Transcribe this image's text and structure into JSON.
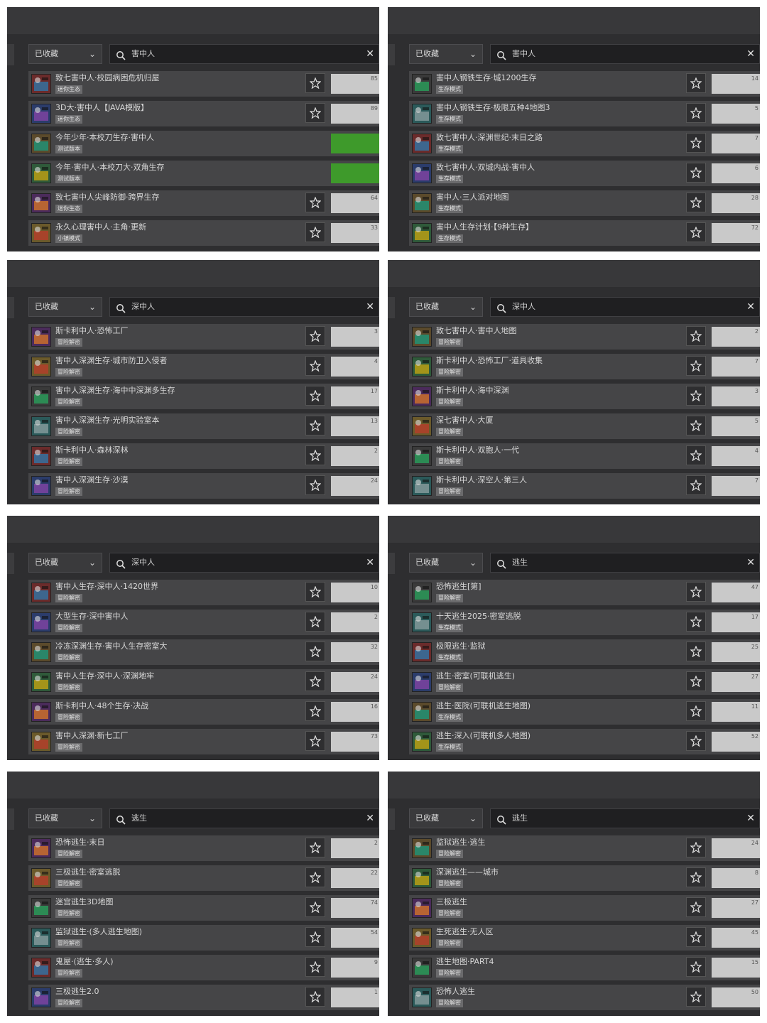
{
  "screenshot": {
    "panels": [
      {
        "dropdown_label": "已收藏",
        "search_value": "害中人",
        "rows": [
          {
            "title": "致七害中人·校园病困危机归屋",
            "badge": "迷你生态",
            "action_value": "85",
            "installed": false
          },
          {
            "title": "3D大·害中人【JAVA模版】",
            "badge": "迷你生态",
            "action_value": "89",
            "installed": false
          },
          {
            "title": "今年少年·本校刀生存·害中人",
            "badge": "测试版本",
            "action_value": "",
            "installed": true
          },
          {
            "title": "今年·害中人·本校刀大·双角生存",
            "badge": "测试版本",
            "action_value": "",
            "installed": true
          },
          {
            "title": "致七害中人尖峰防御·跨界生存",
            "badge": "迷你生态",
            "action_value": "64",
            "installed": false
          },
          {
            "title": "永久心理害中人·主角·更新",
            "badge": "小镇模式",
            "action_value": "33",
            "installed": false
          }
        ]
      },
      {
        "dropdown_label": "已收藏",
        "search_value": "害中人",
        "rows": [
          {
            "title": "害中人钢铁生存·城1200生存",
            "badge": "生存模式",
            "action_value": "14",
            "installed": false
          },
          {
            "title": "害中人钢铁生存·极限五种4地图3",
            "badge": "生存模式",
            "action_value": "5",
            "installed": false
          },
          {
            "title": "致七害中人·深渊世纪·末日之路",
            "badge": "生存模式",
            "action_value": "7",
            "installed": false
          },
          {
            "title": "致七害中人·双城内战·害中人",
            "badge": "生存模式",
            "action_value": "6",
            "installed": false
          },
          {
            "title": "害中人·三人派对地图",
            "badge": "生存模式",
            "action_value": "28",
            "installed": false
          },
          {
            "title": "害中人生存计划·【9种生存】",
            "badge": "生存模式",
            "action_value": "72",
            "installed": false
          }
        ]
      },
      {
        "dropdown_label": "已收藏",
        "search_value": "深中人",
        "rows": [
          {
            "title": "斯卡利中人·恐怖工厂",
            "badge": "冒险解密",
            "action_value": "3",
            "installed": false
          },
          {
            "title": "害中人深渊生存·城市防卫入侵者",
            "badge": "冒险解密",
            "action_value": "4",
            "installed": false
          },
          {
            "title": "害中人深渊生存·海中中深渊多生存",
            "badge": "冒险解密",
            "action_value": "17",
            "installed": false
          },
          {
            "title": "害中人深渊生存·光明实验室本",
            "badge": "冒险解密",
            "action_value": "13",
            "installed": false
          },
          {
            "title": "斯卡利中人·森林深林",
            "badge": "冒险解密",
            "action_value": "2",
            "installed": false
          },
          {
            "title": "害中人深渊生存·沙漠",
            "badge": "冒险解密",
            "action_value": "24",
            "installed": false
          }
        ]
      },
      {
        "dropdown_label": "已收藏",
        "search_value": "深中人",
        "rows": [
          {
            "title": "致七害中人·害中人地图",
            "badge": "冒险解密",
            "action_value": "2",
            "installed": false
          },
          {
            "title": "斯卡利中人·恐怖工厂·道具收集",
            "badge": "冒险解密",
            "action_value": "7",
            "installed": false
          },
          {
            "title": "斯卡利中人·海中深渊",
            "badge": "冒险解密",
            "action_value": "3",
            "installed": false
          },
          {
            "title": "深七害中人·大厦",
            "badge": "冒险解密",
            "action_value": "5",
            "installed": false
          },
          {
            "title": "斯卡利中人·双胞人·一代",
            "badge": "冒险解密",
            "action_value": "4",
            "installed": false
          },
          {
            "title": "斯卡利中人·深空人·第三人",
            "badge": "冒险解密",
            "action_value": "7",
            "installed": false
          }
        ]
      },
      {
        "dropdown_label": "已收藏",
        "search_value": "深中人",
        "rows": [
          {
            "title": "害中人生存·深中人·1420世界",
            "badge": "冒险解密",
            "action_value": "10",
            "installed": false
          },
          {
            "title": "大型生存·深中害中人",
            "badge": "冒险解密",
            "action_value": "2",
            "installed": false
          },
          {
            "title": "冷冻深渊生存·害中人生存密室大",
            "badge": "冒险解密",
            "action_value": "32",
            "installed": false
          },
          {
            "title": "害中人生存·深中人·深渊地牢",
            "badge": "冒险解密",
            "action_value": "24",
            "installed": false
          },
          {
            "title": "斯卡利中人·48个生存·决战",
            "badge": "冒险解密",
            "action_value": "16",
            "installed": false
          },
          {
            "title": "害中人深渊·新七工厂",
            "badge": "冒险解密",
            "action_value": "73",
            "installed": false
          }
        ]
      },
      {
        "dropdown_label": "已收藏",
        "search_value": "逃生",
        "rows": [
          {
            "title": "恐怖逃生[第]",
            "badge": "冒险解密",
            "action_value": "47",
            "installed": false
          },
          {
            "title": "十天逃生2025·密室逃脱",
            "badge": "生存模式",
            "action_value": "17",
            "installed": false
          },
          {
            "title": "极限逃生·监狱",
            "badge": "生存模式",
            "action_value": "25",
            "installed": false
          },
          {
            "title": "逃生·密室(可联机逃生)",
            "badge": "冒险解密",
            "action_value": "27",
            "installed": false
          },
          {
            "title": "逃生·医院(可联机逃生地图)",
            "badge": "生存模式",
            "action_value": "11",
            "installed": false
          },
          {
            "title": "逃生·深入(可联机多人地图)",
            "badge": "生存模式",
            "action_value": "52",
            "installed": false
          }
        ]
      },
      {
        "dropdown_label": "已收藏",
        "search_value": "逃生",
        "rows": [
          {
            "title": "恐怖逃生·末日",
            "badge": "冒险解密",
            "action_value": "2",
            "installed": false
          },
          {
            "title": "三极逃生·密室逃脱",
            "badge": "冒险解密",
            "action_value": "22",
            "installed": false
          },
          {
            "title": "迷宫逃生3D地图",
            "badge": "冒险解密",
            "action_value": "74",
            "installed": false
          },
          {
            "title": "监狱逃生·(多人逃生地图)",
            "badge": "冒险解密",
            "action_value": "54",
            "installed": false
          },
          {
            "title": "鬼屋·(逃生·多人)",
            "badge": "冒险解密",
            "action_value": "9",
            "installed": false
          },
          {
            "title": "三极逃生2.0",
            "badge": "冒险解密",
            "action_value": "1",
            "installed": false
          }
        ]
      },
      {
        "dropdown_label": "已收藏",
        "search_value": "逃生",
        "rows": [
          {
            "title": "监狱逃生·逃生",
            "badge": "冒险解密",
            "action_value": "24",
            "installed": false
          },
          {
            "title": "深渊逃生——城市",
            "badge": "冒险解密",
            "action_value": "8",
            "installed": false
          },
          {
            "title": "三极逃生",
            "badge": "冒险解密",
            "action_value": "27",
            "installed": false
          },
          {
            "title": "生死逃生·无人区",
            "badge": "冒险解密",
            "action_value": "45",
            "installed": false
          },
          {
            "title": "逃生地图·PART4",
            "badge": "冒险解密",
            "action_value": "15",
            "installed": false
          },
          {
            "title": "恐怖人逃生",
            "badge": "冒险解密",
            "action_value": "50",
            "installed": false
          }
        ]
      }
    ]
  },
  "colors": {
    "panel_bg": "#2e2e30",
    "row_bg": "#454547",
    "installed_green": "#3e9a2b",
    "action_grey": "#c9c9c9"
  },
  "icons": {
    "search": "search-icon",
    "dropdown": "chevron-down-icon",
    "clear": "close-icon",
    "favorite": "star-outline-icon"
  }
}
